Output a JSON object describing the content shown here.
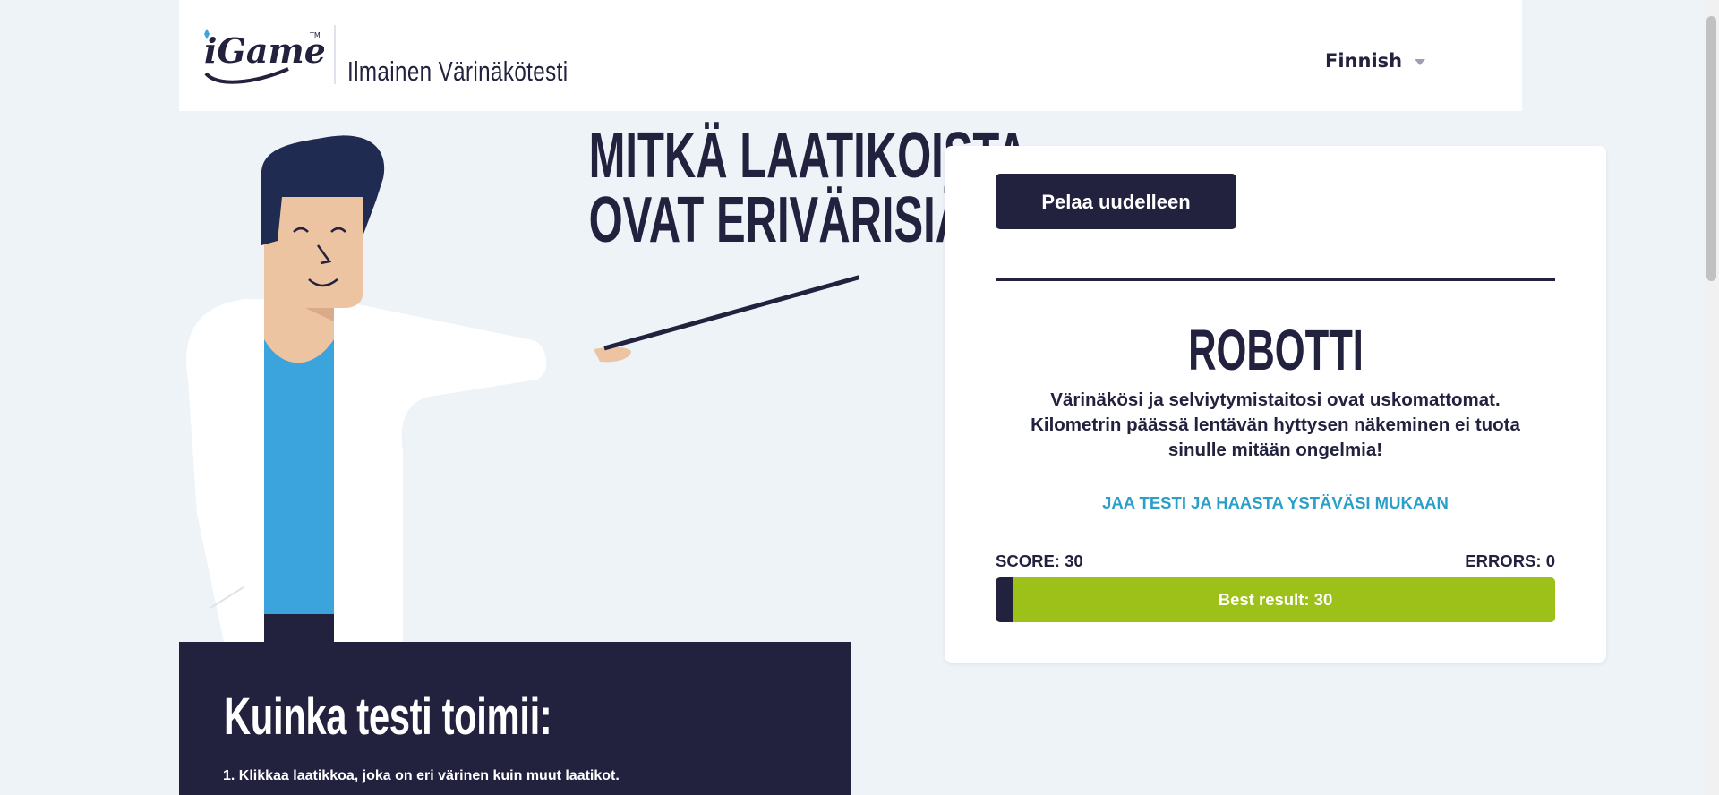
{
  "header": {
    "logo_text": "iGame",
    "site_title": "Ilmainen Värinäkötesti",
    "language": "Finnish"
  },
  "hero": {
    "question_line1": "MITKÄ LAATIKOISTA",
    "question_line2": "OVAT ERIVÄRISIÄ?"
  },
  "how_it_works": {
    "title": "Kuinka testi toimii:",
    "step1": "1. Klikkaa laatikkoa, joka on eri värinen kuin muut laatikot."
  },
  "result_card": {
    "play_again_label": "Pelaa uudelleen",
    "result_title": "ROBOTTI",
    "result_text": "Värinäkösi ja selviytymistaitosi ovat uskomattomat. Kilometrin päässä lentävän hyttysen näkeminen ei tuota sinulle mitään ongelmia!",
    "share_label": "JAA TESTI JA HAASTA YSTÄVÄSI MUKAAN",
    "score_label": "SCORE: 30",
    "errors_label": "ERRORS: 0",
    "best_result_label": "Best result: 30",
    "progress_fraction": 0.03
  },
  "colors": {
    "navy": "#22223f",
    "background": "#eef3f8",
    "accent_green": "#9ec11a",
    "link_blue": "#2a9fc8",
    "shirt_blue": "#3ba4dc",
    "skin": "#ecc4a2"
  }
}
